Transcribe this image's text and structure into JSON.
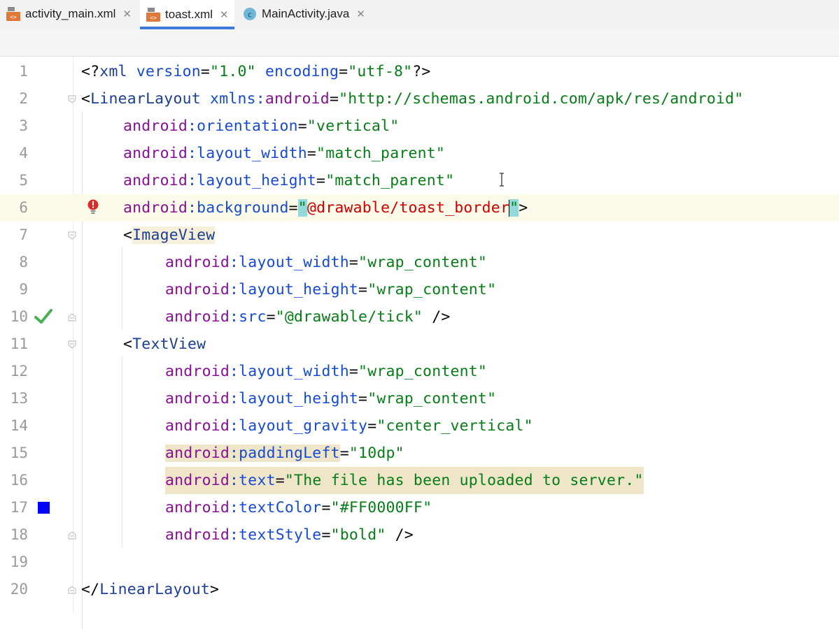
{
  "tabs": [
    {
      "label": "activity_main.xml",
      "icon": "xml-file-icon",
      "active": false
    },
    {
      "label": "toast.xml",
      "icon": "xml-file-icon",
      "active": true
    },
    {
      "label": "MainActivity.java",
      "icon": "java-class-icon",
      "active": false
    }
  ],
  "tab_close_glyph": "✕",
  "line_numbers": [
    "1",
    "2",
    "3",
    "4",
    "5",
    "6",
    "7",
    "8",
    "9",
    "10",
    "11",
    "12",
    "13",
    "14",
    "15",
    "16",
    "17",
    "18",
    "19",
    "20"
  ],
  "code": {
    "l1": {
      "a": "<?",
      "b": "xml ",
      "c": "version",
      "d": "=",
      "e": "\"1.0\"",
      "f": " ",
      "g": "encoding",
      "h": "=",
      "i": "\"utf-8\"",
      "j": "?>"
    },
    "l2": {
      "a": "<",
      "b": "LinearLayout",
      "c": " ",
      "d": "xmlns:",
      "e": "android",
      "f": "=",
      "g": "\"http://schemas.android.com/apk/res/android\""
    },
    "l3": {
      "ns": "android",
      "attr": ":orientation",
      "eq": "=",
      "val": "\"vertical\""
    },
    "l4": {
      "ns": "android",
      "attr": ":layout_width",
      "eq": "=",
      "val": "\"match_parent\""
    },
    "l5": {
      "ns": "android",
      "attr": ":layout_height",
      "eq": "=",
      "val": "\"match_parent\""
    },
    "l6": {
      "ns": "android",
      "attr": ":background",
      "eq": "=",
      "q1": "\"",
      "val": "@drawable/toast_border",
      "q2": "\"",
      "end": ">"
    },
    "l7": {
      "lt": "<",
      "tag": "ImageView"
    },
    "l8": {
      "ns": "android",
      "attr": ":layout_width",
      "eq": "=",
      "val": "\"wrap_content\""
    },
    "l9": {
      "ns": "android",
      "attr": ":layout_height",
      "eq": "=",
      "val": "\"wrap_content\""
    },
    "l10": {
      "ns": "android",
      "attr": ":src",
      "eq": "=",
      "val": "\"@drawable/tick\"",
      "end": " />"
    },
    "l11": {
      "lt": "<",
      "tag": "TextView"
    },
    "l12": {
      "ns": "android",
      "attr": ":layout_width",
      "eq": "=",
      "val": "\"wrap_content\""
    },
    "l13": {
      "ns": "android",
      "attr": ":layout_height",
      "eq": "=",
      "val": "\"wrap_content\""
    },
    "l14": {
      "ns": "android",
      "attr": ":layout_gravity",
      "eq": "=",
      "val": "\"center_vertical\""
    },
    "l15": {
      "ns": "android",
      "attr": ":paddingLeft",
      "eq": "=",
      "val": "\"10dp\""
    },
    "l16": {
      "ns": "android",
      "attr": ":text",
      "eq": "=",
      "val": "\"The file has been uploaded to server.\""
    },
    "l17": {
      "ns": "android",
      "attr": ":textColor",
      "eq": "=",
      "val": "\"#FF0000FF\""
    },
    "l18": {
      "ns": "android",
      "attr": ":textStyle",
      "eq": "=",
      "val": "\"bold\"",
      "end": " />"
    },
    "l20": {
      "a": "</",
      "b": "LinearLayout",
      "c": ">"
    }
  },
  "gutter_markers": {
    "line6": "error-bulb-icon",
    "line10": "image-check-icon",
    "line17": "color-swatch-icon"
  },
  "colors": {
    "color_swatch": "#0000ff",
    "check": "#4caf50",
    "error": "#d32f2f",
    "tab_underline": "#3d7bd9"
  }
}
